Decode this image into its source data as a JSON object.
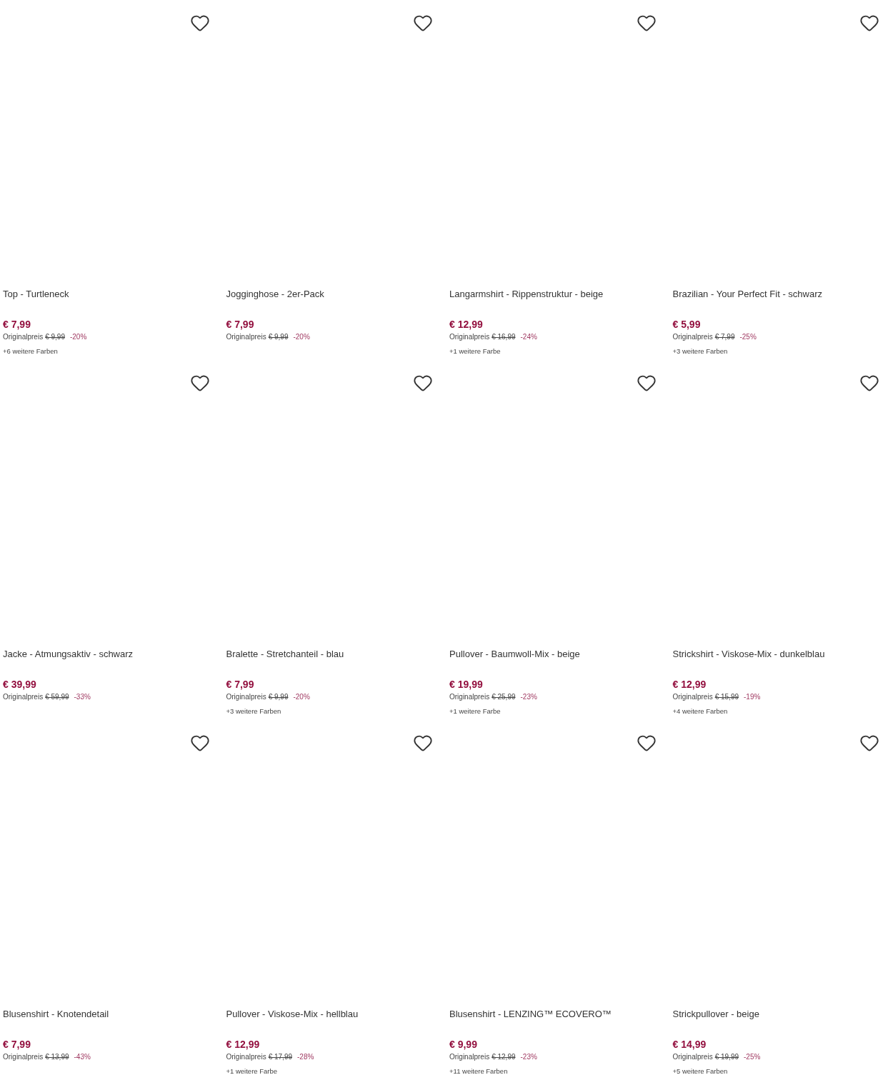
{
  "products": [
    {
      "title": "Top - Turtleneck",
      "price": "€ 7,99",
      "original_label": "Originalpreis",
      "original_price": "€ 9,99",
      "discount": "-20%",
      "colors": "+6 weitere Farben"
    },
    {
      "title": "Jogginghose - 2er-Pack",
      "price": "€ 7,99",
      "original_label": "Originalpreis",
      "original_price": "€ 9,99",
      "discount": "-20%"
    },
    {
      "title": "Langarmshirt - Rippenstruktur - beige",
      "price": "€ 12,99",
      "original_label": "Originalpreis",
      "original_price": "€ 16,99",
      "discount": "-24%",
      "colors": "+1 weitere Farbe"
    },
    {
      "title": "Brazilian - Your Perfect Fit - schwarz",
      "price": "€ 5,99",
      "original_label": "Originalpreis",
      "original_price": "€ 7,99",
      "discount": "-25%",
      "colors": "+3 weitere Farben"
    },
    {
      "title": "Jacke - Atmungsaktiv - schwarz",
      "price": "€ 39,99",
      "original_label": "Originalpreis",
      "original_price": "€ 59,99",
      "discount": "-33%"
    },
    {
      "title": "Bralette - Stretchanteil - blau",
      "price": "€ 7,99",
      "original_label": "Originalpreis",
      "original_price": "€ 9,99",
      "discount": "-20%",
      "colors": "+3 weitere Farben"
    },
    {
      "title": "Pullover - Baumwoll-Mix - beige",
      "price": "€ 19,99",
      "original_label": "Originalpreis",
      "original_price": "€ 25,99",
      "discount": "-23%",
      "colors": "+1 weitere Farbe"
    },
    {
      "title": "Strickshirt - Viskose-Mix - dunkelblau",
      "price": "€ 12,99",
      "original_label": "Originalpreis",
      "original_price": "€ 15,99",
      "discount": "-19%",
      "colors": "+4 weitere Farben"
    },
    {
      "title": "Blusenshirt - Knotendetail",
      "price": "€ 7,99",
      "original_label": "Originalpreis",
      "original_price": "€ 13,99",
      "discount": "-43%"
    },
    {
      "title": "Pullover - Viskose-Mix - hellblau",
      "price": "€ 12,99",
      "original_label": "Originalpreis",
      "original_price": "€ 17,99",
      "discount": "-28%",
      "colors": "+1 weitere Farbe"
    },
    {
      "title": "Blusenshirt - LENZING™ ECOVERO™",
      "price": "€ 9,99",
      "original_label": "Originalpreis",
      "original_price": "€ 12,99",
      "discount": "-23%",
      "colors": "+11 weitere Farben"
    },
    {
      "title": "Strickpullover - beige",
      "price": "€ 14,99",
      "original_label": "Originalpreis",
      "original_price": "€ 19,99",
      "discount": "-25%",
      "colors": "+5 weitere Farben"
    }
  ]
}
